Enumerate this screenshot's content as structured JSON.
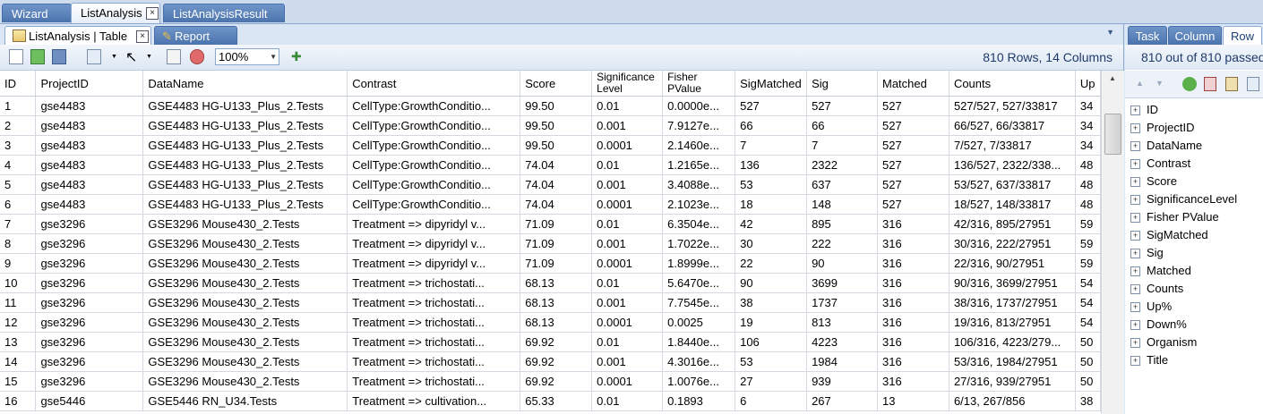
{
  "top_tabs": [
    "Wizard",
    "ListAnalysis",
    "ListAnalysisResult"
  ],
  "sub_tabs": [
    "ListAnalysis | Table",
    "Report"
  ],
  "toolbar": {
    "zoom": "100%",
    "row_count": "810 Rows, 14 Columns"
  },
  "table": {
    "headers": [
      "ID",
      "ProjectID",
      "DataName",
      "Contrast",
      "Score",
      "Significance Level",
      "Fisher PValue",
      "SigMatched",
      "Sig",
      "Matched",
      "Counts",
      "Up"
    ],
    "rows": [
      [
        "1",
        "gse4483",
        "GSE4483 HG-U133_Plus_2.Tests",
        "CellType:GrowthConditio...",
        "99.50",
        "0.01",
        "0.0000e...",
        "527",
        "527",
        "527",
        "527/527, 527/33817",
        "34"
      ],
      [
        "2",
        "gse4483",
        "GSE4483 HG-U133_Plus_2.Tests",
        "CellType:GrowthConditio...",
        "99.50",
        "0.001",
        "7.9127e...",
        "66",
        "66",
        "527",
        "66/527, 66/33817",
        "34"
      ],
      [
        "3",
        "gse4483",
        "GSE4483 HG-U133_Plus_2.Tests",
        "CellType:GrowthConditio...",
        "99.50",
        "0.0001",
        "2.1460e...",
        "7",
        "7",
        "527",
        "7/527, 7/33817",
        "34"
      ],
      [
        "4",
        "gse4483",
        "GSE4483 HG-U133_Plus_2.Tests",
        "CellType:GrowthConditio...",
        "74.04",
        "0.01",
        "1.2165e...",
        "136",
        "2322",
        "527",
        "136/527,  2322/338...",
        "48"
      ],
      [
        "5",
        "gse4483",
        "GSE4483 HG-U133_Plus_2.Tests",
        "CellType:GrowthConditio...",
        "74.04",
        "0.001",
        "3.4088e...",
        "53",
        "637",
        "527",
        "53/527, 637/33817",
        "48"
      ],
      [
        "6",
        "gse4483",
        "GSE4483 HG-U133_Plus_2.Tests",
        "CellType:GrowthConditio...",
        "74.04",
        "0.0001",
        "2.1023e...",
        "18",
        "148",
        "527",
        "18/527, 148/33817",
        "48"
      ],
      [
        "7",
        "gse3296",
        "GSE3296 Mouse430_2.Tests",
        "Treatment => dipyridyl v...",
        "71.09",
        "0.01",
        "6.3504e...",
        "42",
        "895",
        "316",
        "42/316, 895/27951",
        "59"
      ],
      [
        "8",
        "gse3296",
        "GSE3296 Mouse430_2.Tests",
        "Treatment => dipyridyl v...",
        "71.09",
        "0.001",
        "1.7022e...",
        "30",
        "222",
        "316",
        "30/316, 222/27951",
        "59"
      ],
      [
        "9",
        "gse3296",
        "GSE3296 Mouse430_2.Tests",
        "Treatment => dipyridyl v...",
        "71.09",
        "0.0001",
        "1.8999e...",
        "22",
        "90",
        "316",
        "22/316, 90/27951",
        "59"
      ],
      [
        "10",
        "gse3296",
        "GSE3296 Mouse430_2.Tests",
        "Treatment => trichostati...",
        "68.13",
        "0.01",
        "5.6470e...",
        "90",
        "3699",
        "316",
        "90/316, 3699/27951",
        "54"
      ],
      [
        "11",
        "gse3296",
        "GSE3296 Mouse430_2.Tests",
        "Treatment => trichostati...",
        "68.13",
        "0.001",
        "7.7545e...",
        "38",
        "1737",
        "316",
        "38/316, 1737/27951",
        "54"
      ],
      [
        "12",
        "gse3296",
        "GSE3296 Mouse430_2.Tests",
        "Treatment => trichostati...",
        "68.13",
        "0.0001",
        "0.0025",
        "19",
        "813",
        "316",
        "19/316, 813/27951",
        "54"
      ],
      [
        "13",
        "gse3296",
        "GSE3296 Mouse430_2.Tests",
        "Treatment => trichostati...",
        "69.92",
        "0.01",
        "1.8440e...",
        "106",
        "4223",
        "316",
        "106/316,  4223/279...",
        "50"
      ],
      [
        "14",
        "gse3296",
        "GSE3296 Mouse430_2.Tests",
        "Treatment => trichostati...",
        "69.92",
        "0.001",
        "4.3016e...",
        "53",
        "1984",
        "316",
        "53/316, 1984/27951",
        "50"
      ],
      [
        "15",
        "gse3296",
        "GSE3296 Mouse430_2.Tests",
        "Treatment => trichostati...",
        "69.92",
        "0.0001",
        "1.0076e...",
        "27",
        "939",
        "316",
        "27/316, 939/27951",
        "50"
      ],
      [
        "16",
        "gse5446",
        "GSE5446 RN_U34.Tests",
        "Treatment => cultivation...",
        "65.33",
        "0.01",
        "0.1893",
        "6",
        "267",
        "13",
        "6/13, 267/856",
        "38"
      ]
    ]
  },
  "right_panel": {
    "tabs": [
      "Task",
      "Column",
      "Row"
    ],
    "info": "810 out of 810 passed",
    "fields": [
      "ID",
      "ProjectID",
      "DataName",
      "Contrast",
      "Score",
      "SignificanceLevel",
      "Fisher PValue",
      "SigMatched",
      "Sig",
      "Matched",
      "Counts",
      "Up%",
      "Down%",
      "Organism",
      "Title"
    ]
  }
}
